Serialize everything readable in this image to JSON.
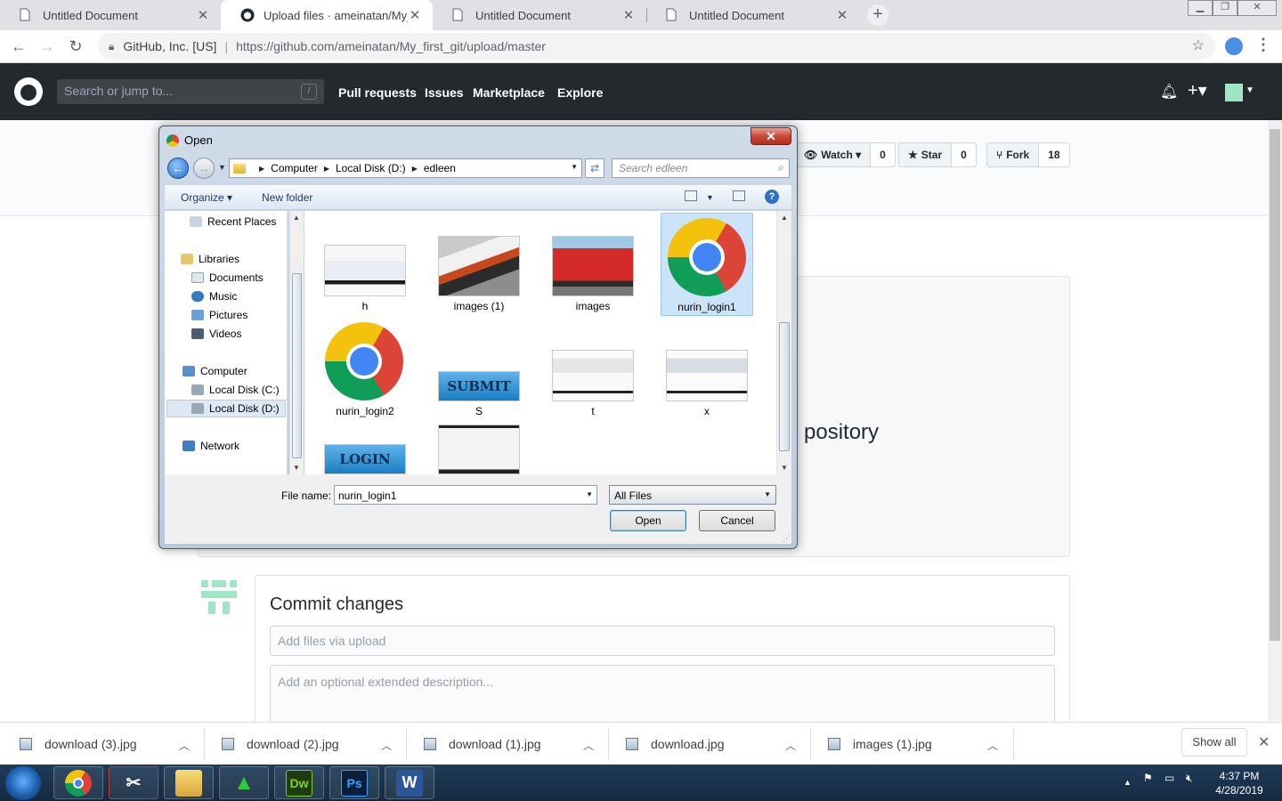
{
  "browser": {
    "tabs": [
      {
        "title": "Untitled Document",
        "active": false
      },
      {
        "title": "Upload files · ameinatan/My_first",
        "active": true
      },
      {
        "title": "Untitled Document",
        "active": false
      },
      {
        "title": "Untitled Document",
        "active": false
      }
    ],
    "new_tab": "+",
    "security_label": "GitHub, Inc. [US]",
    "url": "https://github.com/ameinatan/My_first_git/upload/master"
  },
  "github": {
    "search_placeholder": "Search or jump to...",
    "search_shortcut": "/",
    "nav": [
      "Pull requests",
      "Issues",
      "Marketplace",
      "Explore"
    ],
    "repo_actions": {
      "watch_label": "Watch",
      "watch_count": "0",
      "star_label": "Star",
      "star_count": "0",
      "fork_label": "Fork",
      "fork_count": "18"
    },
    "drop_text_fragment": "pository",
    "commit": {
      "title": "Commit changes",
      "summary_placeholder": "Add files via upload",
      "description_placeholder": "Add an optional extended description..."
    }
  },
  "dialog": {
    "title": "Open",
    "breadcrumb": [
      "Computer",
      "Local Disk (D:)",
      "edleen"
    ],
    "search_placeholder": "Search edleen",
    "toolbar": {
      "organize": "Organize",
      "new_folder": "New folder"
    },
    "nav_items": [
      {
        "label": "Recent Places",
        "icon": "recent-places-icon"
      },
      {
        "label": "Libraries",
        "icon": "libraries-icon"
      },
      {
        "label": "Documents",
        "icon": "documents-icon"
      },
      {
        "label": "Music",
        "icon": "music-icon"
      },
      {
        "label": "Pictures",
        "icon": "pictures-icon"
      },
      {
        "label": "Videos",
        "icon": "videos-icon"
      },
      {
        "label": "Computer",
        "icon": "computer-icon"
      },
      {
        "label": "Local Disk (C:)",
        "icon": "drive-icon"
      },
      {
        "label": "Local Disk (D:)",
        "icon": "drive-icon",
        "selected": true
      },
      {
        "label": "Network",
        "icon": "network-icon"
      }
    ],
    "files": [
      {
        "name": "h",
        "thumb": "screenshot"
      },
      {
        "name": "images (1)",
        "thumb": "bus-photo"
      },
      {
        "name": "images",
        "thumb": "red-bus-photo"
      },
      {
        "name": "nurin_login1",
        "thumb": "chrome-logo",
        "selected": true
      },
      {
        "name": "nurin_login2",
        "thumb": "chrome-logo"
      },
      {
        "name": "S",
        "thumb": "submit-button-image"
      },
      {
        "name": "t",
        "thumb": "screenshot"
      },
      {
        "name": "x",
        "thumb": "screenshot"
      },
      {
        "name": "",
        "thumb": "login-button-image"
      },
      {
        "name": "",
        "thumb": "screenshot"
      }
    ],
    "submit_image_text": "SUBMIT",
    "login_image_text": "LOGIN",
    "file_name_label": "File name:",
    "file_name_value": "nurin_login1",
    "file_type": "All Files",
    "open_button": "Open",
    "cancel_button": "Cancel"
  },
  "downloads": {
    "items": [
      "download (3).jpg",
      "download (2).jpg",
      "download (1).jpg",
      "download.jpg",
      "images (1).jpg"
    ],
    "show_all": "Show all"
  },
  "taskbar": {
    "apps": [
      "chrome-icon",
      "snipping-tool-icon",
      "file-explorer-icon",
      "app-green-icon",
      "dreamweaver-icon",
      "photoshop-icon",
      "word-icon"
    ],
    "dw_label": "Dw",
    "ps_label": "Ps",
    "word_label": "W",
    "time": "4:37 PM",
    "date": "4/28/2019"
  }
}
